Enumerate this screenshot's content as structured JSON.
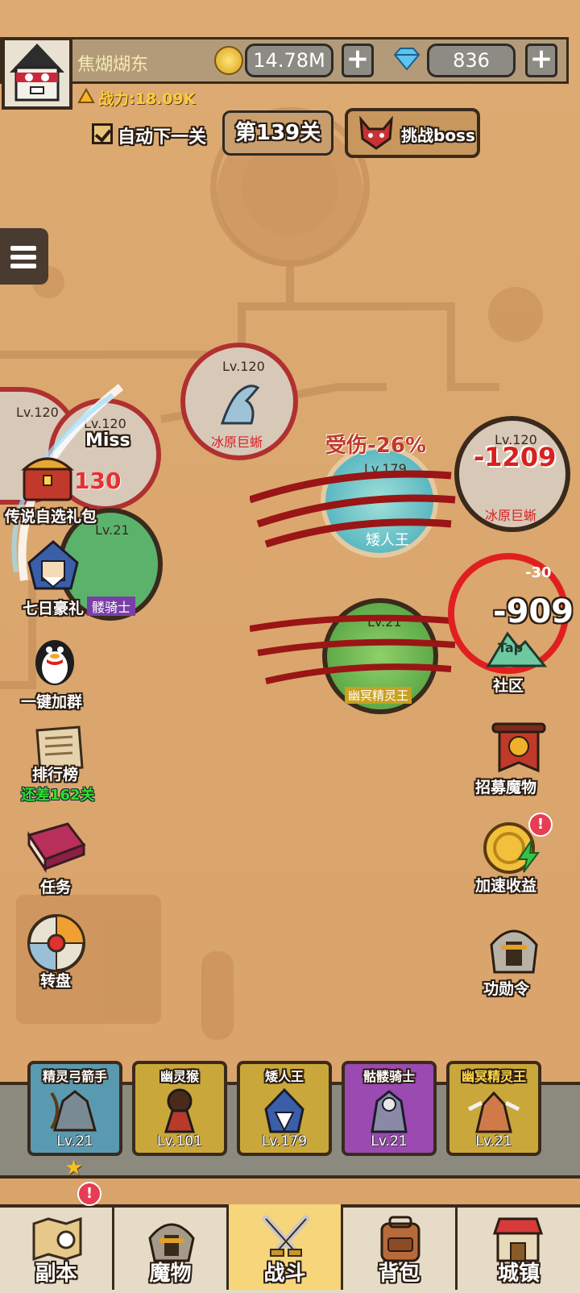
{
  "player": {
    "name": "焦煳煳东",
    "power": "战力:18.09K"
  },
  "currency": {
    "gold": "14.78M",
    "gems": "836",
    "plus": "+"
  },
  "stage": {
    "auto_next_label": "自动下一关",
    "auto_next_checked": true,
    "stage_label": "第139关",
    "boss_button_label": "挑战boss"
  },
  "battle": {
    "dmg_debuff": "受伤-26%",
    "miss": "Miss",
    "hit_partial": "130",
    "damage_1": "-1209",
    "damage_2": "-909",
    "damage_2_small": "-30",
    "tap": "Tap"
  },
  "enemies": [
    {
      "level": "Lv.120",
      "name": "冰原巨蜥"
    },
    {
      "level": "Lv.120",
      "name": "冰原巨蜥"
    },
    {
      "level": "Lv.120",
      "name": "冰原巨蜥"
    },
    {
      "level": "Lv.120",
      "name": ""
    }
  ],
  "allies_map": [
    {
      "level": "Lv.179",
      "name": "矮人王"
    },
    {
      "level": "Lv.21",
      "name": "幽冥精灵王"
    },
    {
      "level": "Lv.21",
      "name": "髅骑士"
    }
  ],
  "left_menu": [
    {
      "label": "传说自选礼包",
      "icon": "treasure-chest-icon"
    },
    {
      "label": "七日豪礼",
      "icon": "samurai-icon"
    },
    {
      "label": "一键加群",
      "icon": "penguin-icon"
    },
    {
      "label": "排行榜",
      "sub": "还差162关",
      "icon": "scroll-icon"
    },
    {
      "label": "任务",
      "icon": "book-icon"
    },
    {
      "label": "转盘",
      "icon": "wheel-icon"
    }
  ],
  "right_menu": [
    {
      "label": "社区",
      "icon": "tap-mountain-icon"
    },
    {
      "label": "招募魔物",
      "icon": "banner-icon"
    },
    {
      "label": "加速收益",
      "icon": "coin-arrow-icon",
      "badge": "!"
    },
    {
      "label": "功勋令",
      "icon": "helmet-icon"
    }
  ],
  "team": [
    {
      "name": "精灵弓箭手",
      "level": "Lv.21",
      "color": "#5a9ab0"
    },
    {
      "name": "幽灵猴",
      "level": "Lv.101",
      "color": "#c9a73a"
    },
    {
      "name": "矮人王",
      "level": "Lv.179",
      "color": "#c9a73a"
    },
    {
      "name": "骷髅骑士",
      "level": "Lv.21",
      "color": "#9a4ab0"
    },
    {
      "name": "幽冥精灵王",
      "level": "Lv.21",
      "color": "#c9a73a"
    }
  ],
  "nav": [
    {
      "label": "副本",
      "badge": "!"
    },
    {
      "label": "魔物"
    },
    {
      "label": "战斗",
      "active": true
    },
    {
      "label": "背包"
    },
    {
      "label": "城镇"
    }
  ]
}
